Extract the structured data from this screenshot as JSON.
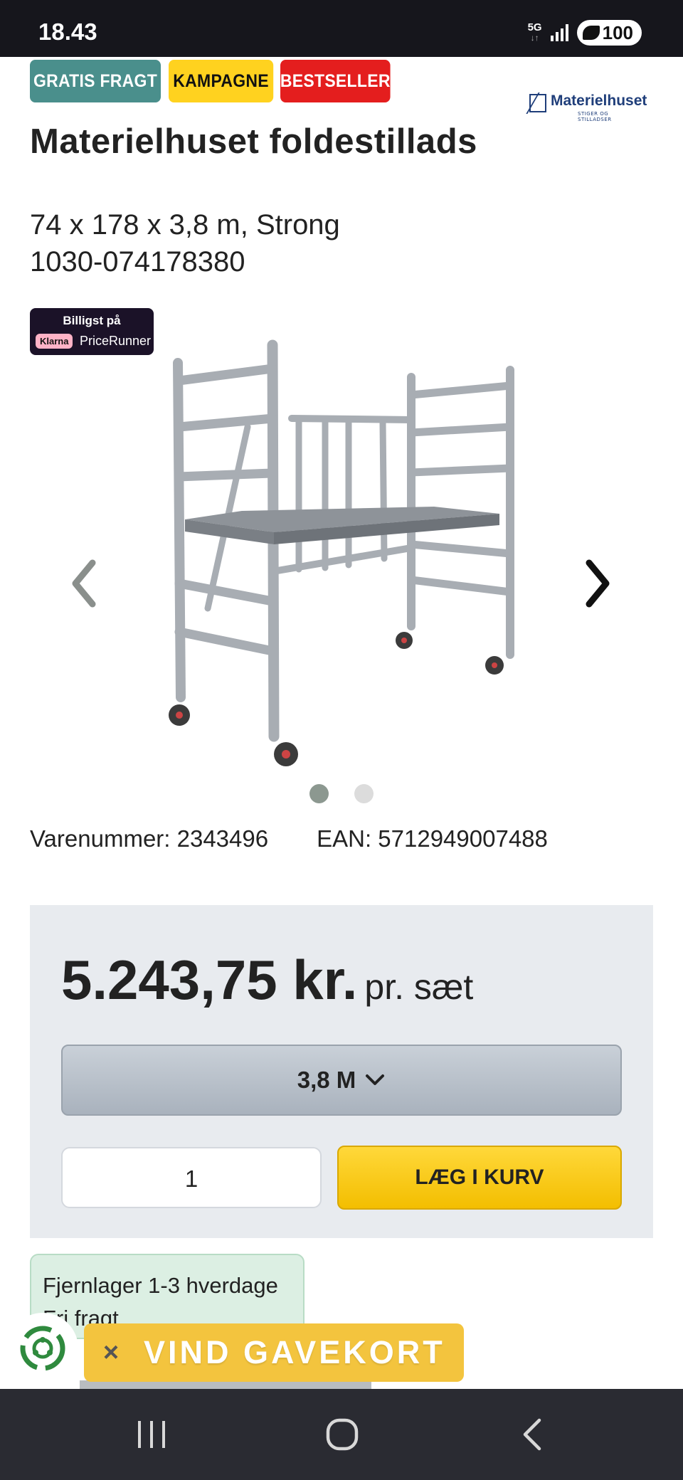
{
  "status": {
    "time": "18.43",
    "network": "5G",
    "battery": "100"
  },
  "badges": [
    "GRATIS FRAGT",
    "KAMPAGNE",
    "BESTSELLER"
  ],
  "brand": {
    "name": "Materielhuset",
    "tagline": "STIGER OG STILLADSER",
    "color": "#1f3e7a"
  },
  "product": {
    "title": "Materielhuset foldestillads",
    "subtitle_line1": "74 x 178 x 3,8 m, Strong",
    "subtitle_line2": "1030-074178380",
    "varenummer": "Varenummer: 2343496",
    "ean": "EAN: 5712949007488"
  },
  "pricerunner": {
    "top": "Billigst på",
    "klarna": "Klarna",
    "brand": "PriceRunner"
  },
  "carousel": {
    "total": 2,
    "active_index": 0
  },
  "purchase": {
    "price": "5.243,75 kr.",
    "unit": "pr. sæt",
    "variant": "3,8 M",
    "quantity": "1",
    "add_to_cart": "LÆG I KURV"
  },
  "stock": {
    "line1": "Fjernlager 1-3 hverdage",
    "line2": "Fri fragt"
  },
  "gift": {
    "close": "×",
    "label": "VIND GAVEKORT"
  },
  "colors": {
    "gratis_fragt": "#4a8f8c",
    "kampagne": "#ffd21f",
    "bestseller": "#e41e1e",
    "cart_button": "#f5c400",
    "stock_bg": "#dcefe3",
    "gift_banner": "#f3c43e"
  },
  "icons": {
    "prev": "chevron-left-icon",
    "next": "chevron-right-icon",
    "variant": "chevron-down-icon",
    "gift": "recycle-icon"
  }
}
